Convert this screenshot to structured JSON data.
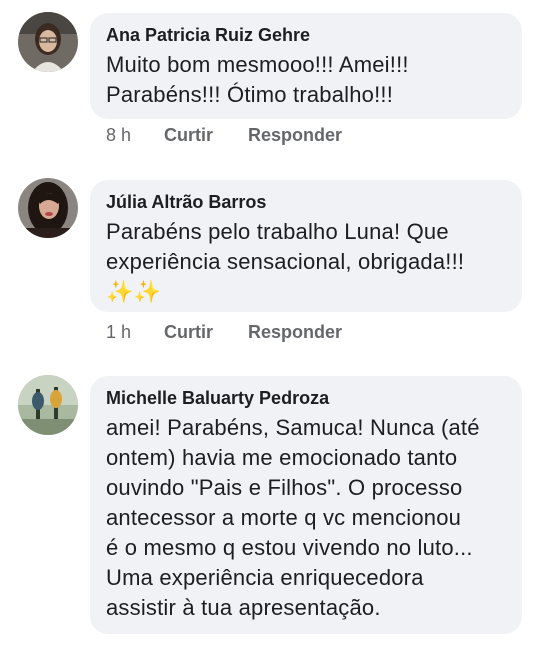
{
  "comments": [
    {
      "author": "Ana Patricia Ruiz Gehre",
      "lines": [
        "Muito bom mesmooo!!! Amei!!!",
        "Parabéns!!! Ótimo trabalho!!!"
      ],
      "time": "8 h",
      "like_label": "Curtir",
      "reply_label": "Responder"
    },
    {
      "author": "Júlia Altrão Barros",
      "lines": [
        "Parabéns pelo trabalho Luna! Que",
        "experiência sensacional, obrigada!!!",
        "✨✨"
      ],
      "time": "1 h",
      "like_label": "Curtir",
      "reply_label": "Responder"
    },
    {
      "author": "Michelle Baluarty Pedroza",
      "lines": [
        "amei! Parabéns, Samuca! Nunca (até",
        "ontem) havia me emocionado tanto",
        "ouvindo \"Pais e Filhos\". O processo",
        "antecessor a morte q vc mencionou",
        "é o mesmo q estou vivendo no luto...",
        "Uma experiência enriquecedora",
        "assistir à tua apresentação."
      ]
    }
  ],
  "icons": {
    "avatar": "user-avatar-photo",
    "emoji": "sparkles-emoji"
  }
}
